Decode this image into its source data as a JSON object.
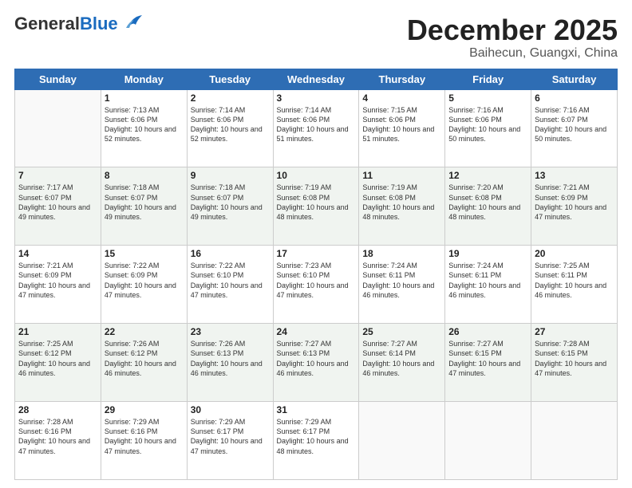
{
  "header": {
    "logo_general": "General",
    "logo_blue": "Blue",
    "month": "December 2025",
    "location": "Baihecun, Guangxi, China"
  },
  "days_of_week": [
    "Sunday",
    "Monday",
    "Tuesday",
    "Wednesday",
    "Thursday",
    "Friday",
    "Saturday"
  ],
  "weeks": [
    [
      {
        "day": "",
        "info": ""
      },
      {
        "day": "1",
        "info": "Sunrise: 7:13 AM\nSunset: 6:06 PM\nDaylight: 10 hours and 52 minutes."
      },
      {
        "day": "2",
        "info": "Sunrise: 7:14 AM\nSunset: 6:06 PM\nDaylight: 10 hours and 52 minutes."
      },
      {
        "day": "3",
        "info": "Sunrise: 7:14 AM\nSunset: 6:06 PM\nDaylight: 10 hours and 51 minutes."
      },
      {
        "day": "4",
        "info": "Sunrise: 7:15 AM\nSunset: 6:06 PM\nDaylight: 10 hours and 51 minutes."
      },
      {
        "day": "5",
        "info": "Sunrise: 7:16 AM\nSunset: 6:06 PM\nDaylight: 10 hours and 50 minutes."
      },
      {
        "day": "6",
        "info": "Sunrise: 7:16 AM\nSunset: 6:07 PM\nDaylight: 10 hours and 50 minutes."
      }
    ],
    [
      {
        "day": "7",
        "info": "Sunrise: 7:17 AM\nSunset: 6:07 PM\nDaylight: 10 hours and 49 minutes."
      },
      {
        "day": "8",
        "info": "Sunrise: 7:18 AM\nSunset: 6:07 PM\nDaylight: 10 hours and 49 minutes."
      },
      {
        "day": "9",
        "info": "Sunrise: 7:18 AM\nSunset: 6:07 PM\nDaylight: 10 hours and 49 minutes."
      },
      {
        "day": "10",
        "info": "Sunrise: 7:19 AM\nSunset: 6:08 PM\nDaylight: 10 hours and 48 minutes."
      },
      {
        "day": "11",
        "info": "Sunrise: 7:19 AM\nSunset: 6:08 PM\nDaylight: 10 hours and 48 minutes."
      },
      {
        "day": "12",
        "info": "Sunrise: 7:20 AM\nSunset: 6:08 PM\nDaylight: 10 hours and 48 minutes."
      },
      {
        "day": "13",
        "info": "Sunrise: 7:21 AM\nSunset: 6:09 PM\nDaylight: 10 hours and 47 minutes."
      }
    ],
    [
      {
        "day": "14",
        "info": "Sunrise: 7:21 AM\nSunset: 6:09 PM\nDaylight: 10 hours and 47 minutes."
      },
      {
        "day": "15",
        "info": "Sunrise: 7:22 AM\nSunset: 6:09 PM\nDaylight: 10 hours and 47 minutes."
      },
      {
        "day": "16",
        "info": "Sunrise: 7:22 AM\nSunset: 6:10 PM\nDaylight: 10 hours and 47 minutes."
      },
      {
        "day": "17",
        "info": "Sunrise: 7:23 AM\nSunset: 6:10 PM\nDaylight: 10 hours and 47 minutes."
      },
      {
        "day": "18",
        "info": "Sunrise: 7:24 AM\nSunset: 6:11 PM\nDaylight: 10 hours and 46 minutes."
      },
      {
        "day": "19",
        "info": "Sunrise: 7:24 AM\nSunset: 6:11 PM\nDaylight: 10 hours and 46 minutes."
      },
      {
        "day": "20",
        "info": "Sunrise: 7:25 AM\nSunset: 6:11 PM\nDaylight: 10 hours and 46 minutes."
      }
    ],
    [
      {
        "day": "21",
        "info": "Sunrise: 7:25 AM\nSunset: 6:12 PM\nDaylight: 10 hours and 46 minutes."
      },
      {
        "day": "22",
        "info": "Sunrise: 7:26 AM\nSunset: 6:12 PM\nDaylight: 10 hours and 46 minutes."
      },
      {
        "day": "23",
        "info": "Sunrise: 7:26 AM\nSunset: 6:13 PM\nDaylight: 10 hours and 46 minutes."
      },
      {
        "day": "24",
        "info": "Sunrise: 7:27 AM\nSunset: 6:13 PM\nDaylight: 10 hours and 46 minutes."
      },
      {
        "day": "25",
        "info": "Sunrise: 7:27 AM\nSunset: 6:14 PM\nDaylight: 10 hours and 46 minutes."
      },
      {
        "day": "26",
        "info": "Sunrise: 7:27 AM\nSunset: 6:15 PM\nDaylight: 10 hours and 47 minutes."
      },
      {
        "day": "27",
        "info": "Sunrise: 7:28 AM\nSunset: 6:15 PM\nDaylight: 10 hours and 47 minutes."
      }
    ],
    [
      {
        "day": "28",
        "info": "Sunrise: 7:28 AM\nSunset: 6:16 PM\nDaylight: 10 hours and 47 minutes."
      },
      {
        "day": "29",
        "info": "Sunrise: 7:29 AM\nSunset: 6:16 PM\nDaylight: 10 hours and 47 minutes."
      },
      {
        "day": "30",
        "info": "Sunrise: 7:29 AM\nSunset: 6:17 PM\nDaylight: 10 hours and 47 minutes."
      },
      {
        "day": "31",
        "info": "Sunrise: 7:29 AM\nSunset: 6:17 PM\nDaylight: 10 hours and 48 minutes."
      },
      {
        "day": "",
        "info": ""
      },
      {
        "day": "",
        "info": ""
      },
      {
        "day": "",
        "info": ""
      }
    ]
  ]
}
